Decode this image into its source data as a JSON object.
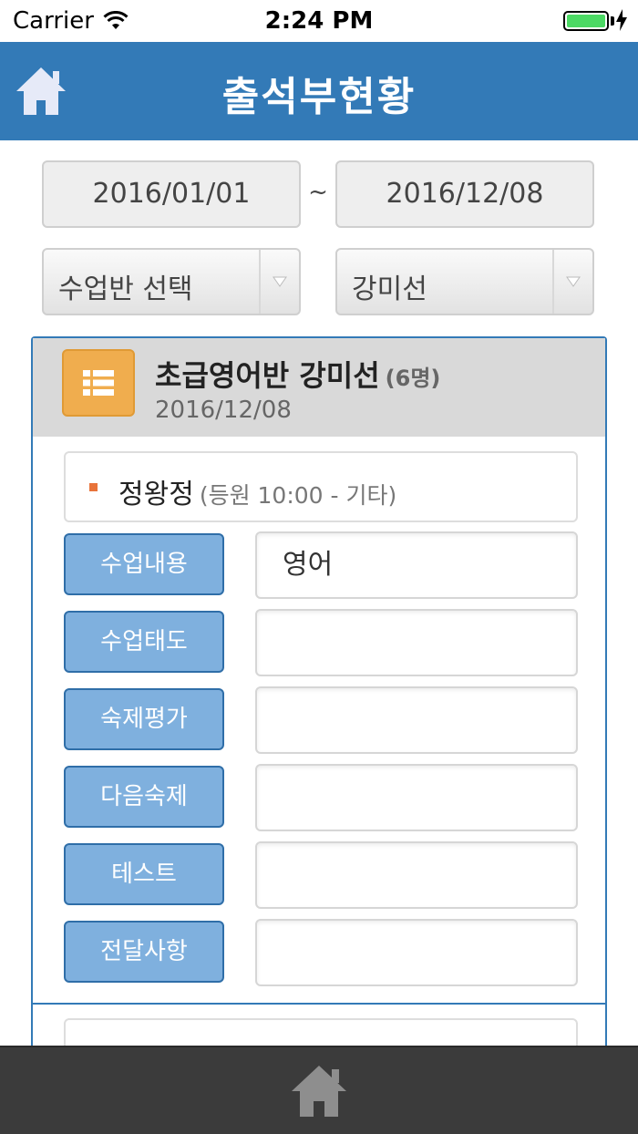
{
  "status_bar": {
    "carrier": "Carrier",
    "time": "2:24 PM",
    "battery_level": 1.0,
    "battery_color": "#4cd964"
  },
  "header": {
    "title": "출석부현황",
    "home_icon": "home-icon",
    "background": "#337ab7"
  },
  "filters": {
    "date_from": "2016/01/01",
    "separator": "~",
    "date_to": "2016/12/08",
    "class_select": "수업반 선택",
    "teacher_select": "강미선"
  },
  "class_panel": {
    "title": "초급영어반 강미선",
    "count": "(6명)",
    "date": "2016/12/08",
    "icon": "list-icon",
    "icon_color": "#f0ad4e"
  },
  "student": {
    "name": "정왕정",
    "note": "(등원 10:00 - 기타)",
    "fields": [
      {
        "label": "수업내용",
        "value": "영어"
      },
      {
        "label": "수업태도",
        "value": ""
      },
      {
        "label": "숙제평가",
        "value": ""
      },
      {
        "label": "다음숙제",
        "value": ""
      },
      {
        "label": "테스트",
        "value": ""
      },
      {
        "label": "전달사항",
        "value": ""
      }
    ]
  },
  "tab_bar": {
    "home_icon": "home-icon"
  }
}
